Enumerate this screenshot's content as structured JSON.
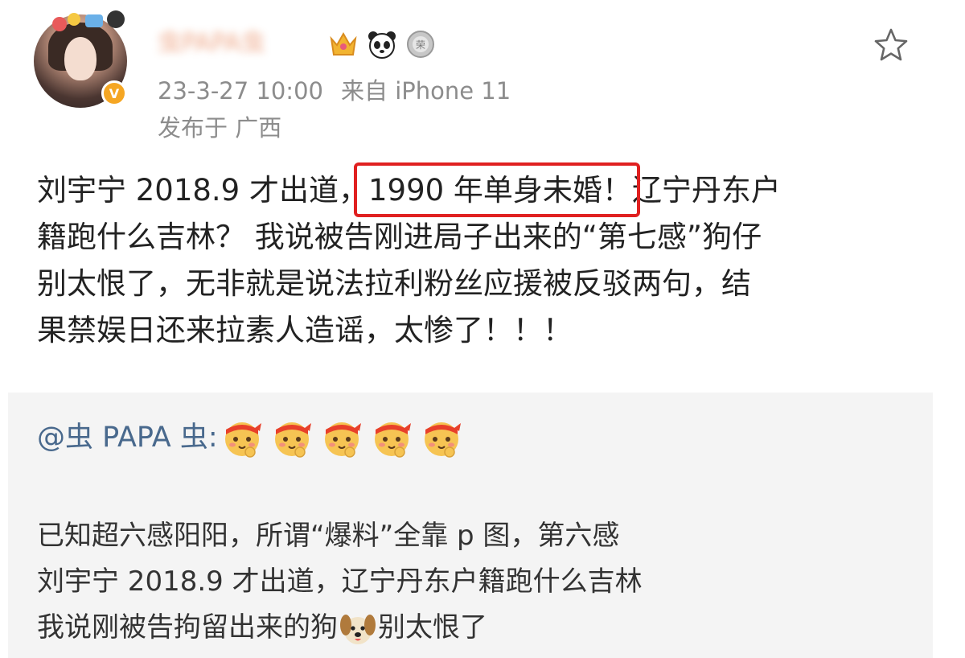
{
  "post": {
    "author": {
      "name_blurred": "虫PAPA虫",
      "badges": [
        "crown-badge-icon",
        "panda-badge-icon",
        "medal-badge-icon"
      ]
    },
    "timestamp": "23-3-27 10:00",
    "source": "来自 iPhone 11",
    "location": "发布于 广西",
    "text_lines": [
      {
        "before": "刘宇宁 2018.9 才出道，",
        "highlight": "1990 年单身未婚！",
        "after": "辽宁丹东户"
      },
      {
        "text": "籍跑什么吉林？ 我说被告刚进局子出来的“第七感”狗仔"
      },
      {
        "text": "别太恨了，无非就是说法拉利粉丝应援被反驳两句，结"
      },
      {
        "text": "果禁娱日还来拉素人造谣，太惨了！！！"
      }
    ]
  },
  "quoted": {
    "mention": "@虫 PAPA 虫:",
    "emoji_count": 5,
    "lines": [
      "已知超六感阳阳，所谓“爆料”全靠 p 图，第六感",
      "刘宇宁 2018.9 才出道，辽宁丹东户籍跑什么吉林"
    ],
    "last_line_before": "我说刚被告拘留出来的狗",
    "last_line_after": "别太恨了"
  },
  "colors": {
    "highlight_border": "#e02020",
    "mention": "#49698d",
    "meta_gray": "#8c8c8c",
    "quote_bg": "#f4f4f4"
  }
}
